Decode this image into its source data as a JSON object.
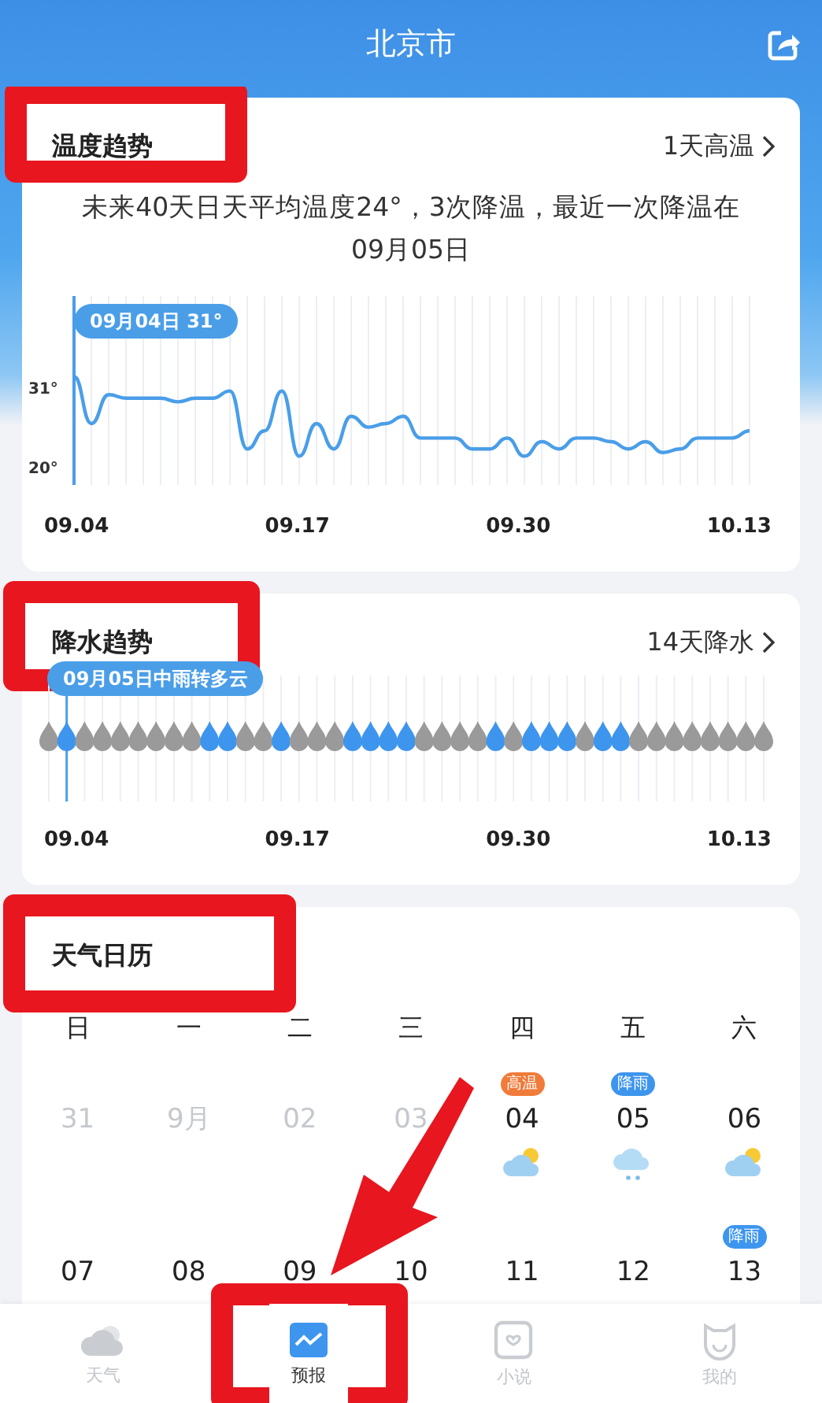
{
  "header": {
    "title": "北京市"
  },
  "temperature": {
    "title": "温度趋势",
    "highlighted": true,
    "link": "1天高温",
    "summary": "未来40天日天平均温度24°，3次降温，最近一次降温在09月05日",
    "tooltip": "09月04日 31°",
    "y_labels": [
      "31°",
      "20°"
    ],
    "x_labels": [
      "09.04",
      "09.17",
      "09.30",
      "10.13"
    ]
  },
  "precipitation": {
    "title": "降水趋势",
    "highlighted": true,
    "link": "14天降水",
    "tooltip": "09月05日中雨转多云",
    "days": [
      {
        "rain": false
      },
      {
        "rain": true
      },
      {
        "rain": false
      },
      {
        "rain": false
      },
      {
        "rain": false
      },
      {
        "rain": false
      },
      {
        "rain": false
      },
      {
        "rain": false
      },
      {
        "rain": false
      },
      {
        "rain": true
      },
      {
        "rain": true
      },
      {
        "rain": false
      },
      {
        "rain": false
      },
      {
        "rain": true
      },
      {
        "rain": false
      },
      {
        "rain": false
      },
      {
        "rain": false
      },
      {
        "rain": true
      },
      {
        "rain": true
      },
      {
        "rain": true
      },
      {
        "rain": true
      },
      {
        "rain": false
      },
      {
        "rain": false
      },
      {
        "rain": false
      },
      {
        "rain": false
      },
      {
        "rain": true
      },
      {
        "rain": false
      },
      {
        "rain": true
      },
      {
        "rain": true
      },
      {
        "rain": true
      },
      {
        "rain": false
      },
      {
        "rain": true
      },
      {
        "rain": true
      },
      {
        "rain": false
      },
      {
        "rain": false
      },
      {
        "rain": false
      },
      {
        "rain": false
      },
      {
        "rain": false
      },
      {
        "rain": false
      },
      {
        "rain": false
      },
      {
        "rain": false
      }
    ],
    "x_labels": [
      "09.04",
      "09.17",
      "09.30",
      "10.13"
    ]
  },
  "calendar": {
    "title": "天气日历",
    "highlighted": true,
    "weekdays": [
      "日",
      "一",
      "二",
      "三",
      "四",
      "五",
      "六"
    ],
    "weeks": [
      [
        {
          "date": "31",
          "muted": true,
          "kind": "blank"
        },
        {
          "date": "9月",
          "muted": true,
          "kind": "blank"
        },
        {
          "date": "02",
          "muted": true,
          "kind": "blank"
        },
        {
          "date": "03",
          "muted": true,
          "kind": "blank"
        },
        {
          "date": "04",
          "muted": false,
          "tag": "高温",
          "color": "#f07b3a",
          "kind": "partly_cloudy"
        },
        {
          "date": "05",
          "muted": false,
          "tag": "降雨",
          "color": "#3d95ee",
          "kind": "rain"
        },
        {
          "date": "06",
          "muted": false,
          "kind": "partly_cloudy"
        }
      ],
      [
        {
          "date": "07",
          "muted": false,
          "kind": "blank"
        },
        {
          "date": "08",
          "muted": false,
          "kind": "blank"
        },
        {
          "date": "09",
          "muted": false,
          "kind": "blank"
        },
        {
          "date": "10",
          "muted": false,
          "kind": "blank"
        },
        {
          "date": "11",
          "muted": false,
          "kind": "blank"
        },
        {
          "date": "12",
          "muted": false,
          "kind": "blank"
        },
        {
          "date": "13",
          "muted": false,
          "tag": "降雨",
          "color": "#3d95ee",
          "kind": "blank"
        }
      ]
    ]
  },
  "tab_bar": [
    {
      "label": "天气",
      "kind": "weather",
      "selected": false,
      "highlighted": false
    },
    {
      "label": "预报",
      "kind": "forecast",
      "selected": true,
      "highlighted": true
    },
    {
      "label": "小说",
      "kind": "novel",
      "selected": false,
      "highlighted": false
    },
    {
      "label": "我的",
      "kind": "profile",
      "selected": false,
      "highlighted": false
    }
  ],
  "pointer_arrow": true
}
